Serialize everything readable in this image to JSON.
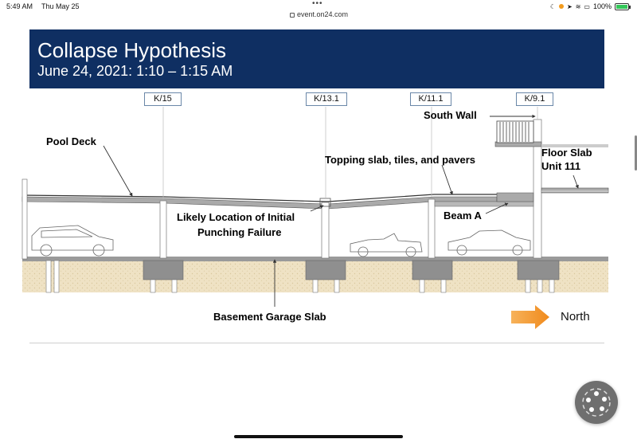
{
  "status_bar": {
    "time": "5:49 AM",
    "date": "Thu May 25",
    "url": "event.on24.com",
    "battery": "100%",
    "battery_level": 1.0
  },
  "slide": {
    "title": "Collapse Hypothesis",
    "subtitle": "June 24, 2021: 1:10 – 1:15 AM",
    "header_color": "#0f2f62"
  },
  "diagram": {
    "column_tags": [
      "K/15",
      "K/13.1",
      "K/11.1",
      "K/9.1"
    ],
    "labels": {
      "pool_deck": "Pool Deck",
      "south_wall": "South Wall",
      "floor_slab_line1": "Floor Slab",
      "floor_slab_line2": "Unit 111",
      "topping_slab": "Topping slab, tiles, and pavers",
      "punching_line1": "Likely Location of Initial",
      "punching_line2": "Punching Failure",
      "beam_a": "Beam A",
      "basement": "Basement Garage Slab"
    },
    "north_label": "North",
    "arrow_color": "#f5a13a",
    "soil_color": "#efe2c4"
  },
  "icons": {
    "menu": "floating-menu-icon",
    "lock": "lock-icon",
    "wifi": "wifi-icon",
    "location": "location-arrow-icon"
  }
}
